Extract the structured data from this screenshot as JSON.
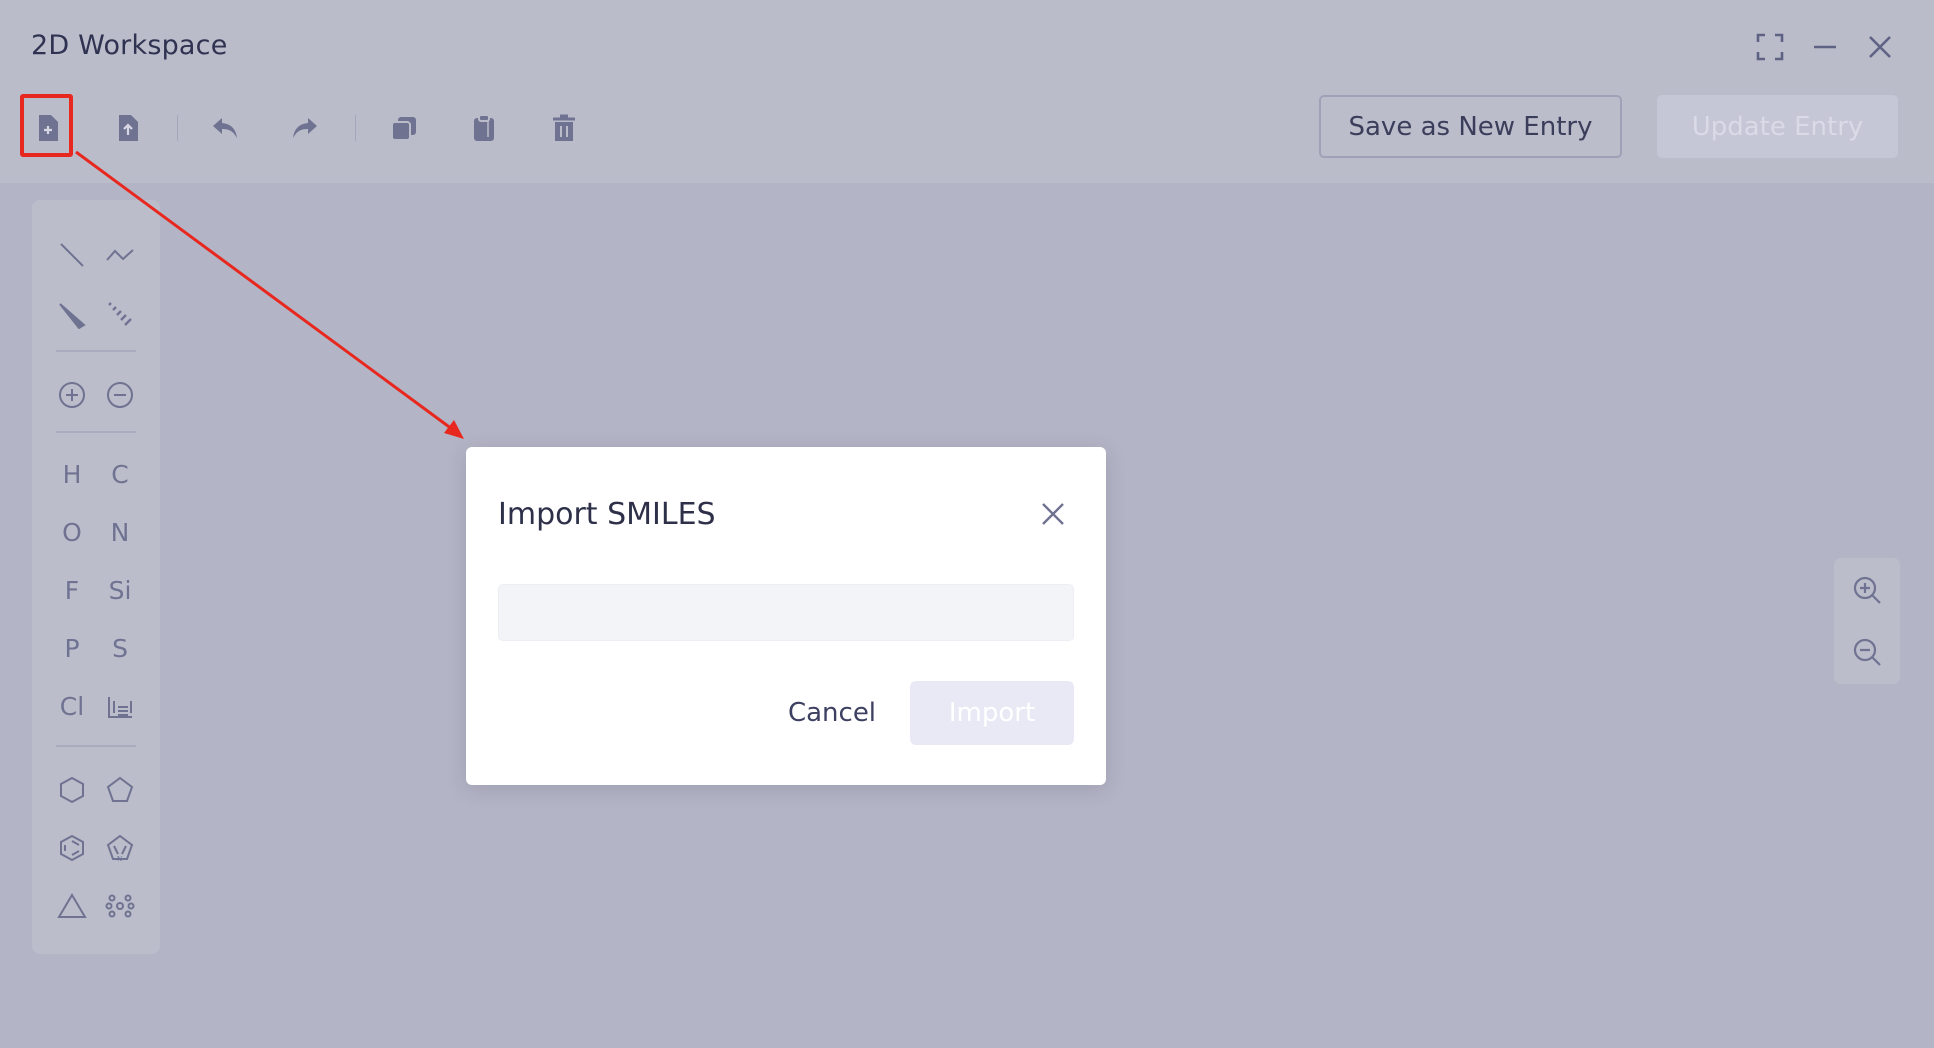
{
  "window": {
    "title": "2D Workspace",
    "controls": [
      "fullscreen-icon",
      "minimize-icon",
      "close-icon"
    ]
  },
  "toolbar": {
    "buttons": [
      "new-file-icon",
      "upload-file-icon",
      "undo-icon",
      "redo-icon",
      "copy-icon",
      "paste-icon",
      "delete-icon"
    ],
    "save_label": "Save as New Entry",
    "update_label": "Update Entry"
  },
  "palette": {
    "bond_tools": [
      "single-bond-icon",
      "chain-bond-icon",
      "wedge-bond-icon",
      "hash-bond-icon"
    ],
    "charge_tools": [
      "positive-charge-icon",
      "negative-charge-icon"
    ],
    "elements": [
      "H",
      "C",
      "O",
      "N",
      "F",
      "Si",
      "P",
      "S",
      "Cl"
    ],
    "periodic_table_icon": "periodic-table-icon",
    "ring_tools": [
      "hexagon-icon",
      "pentagon-icon",
      "benzene-icon",
      "pyrrole-icon",
      "triangle-icon",
      "template-icon"
    ]
  },
  "zoom": {
    "buttons": [
      "zoom-in-icon",
      "zoom-out-icon"
    ]
  },
  "modal": {
    "title": "Import SMILES",
    "input_value": "",
    "input_placeholder": "",
    "cancel_label": "Cancel",
    "import_label": "Import"
  },
  "annotation": {
    "highlight_color": "#e8281f"
  },
  "colors": {
    "overlay": "#b3b5c6",
    "modal_bg": "#ffffff",
    "disabled_button": "#e8e9f5"
  }
}
